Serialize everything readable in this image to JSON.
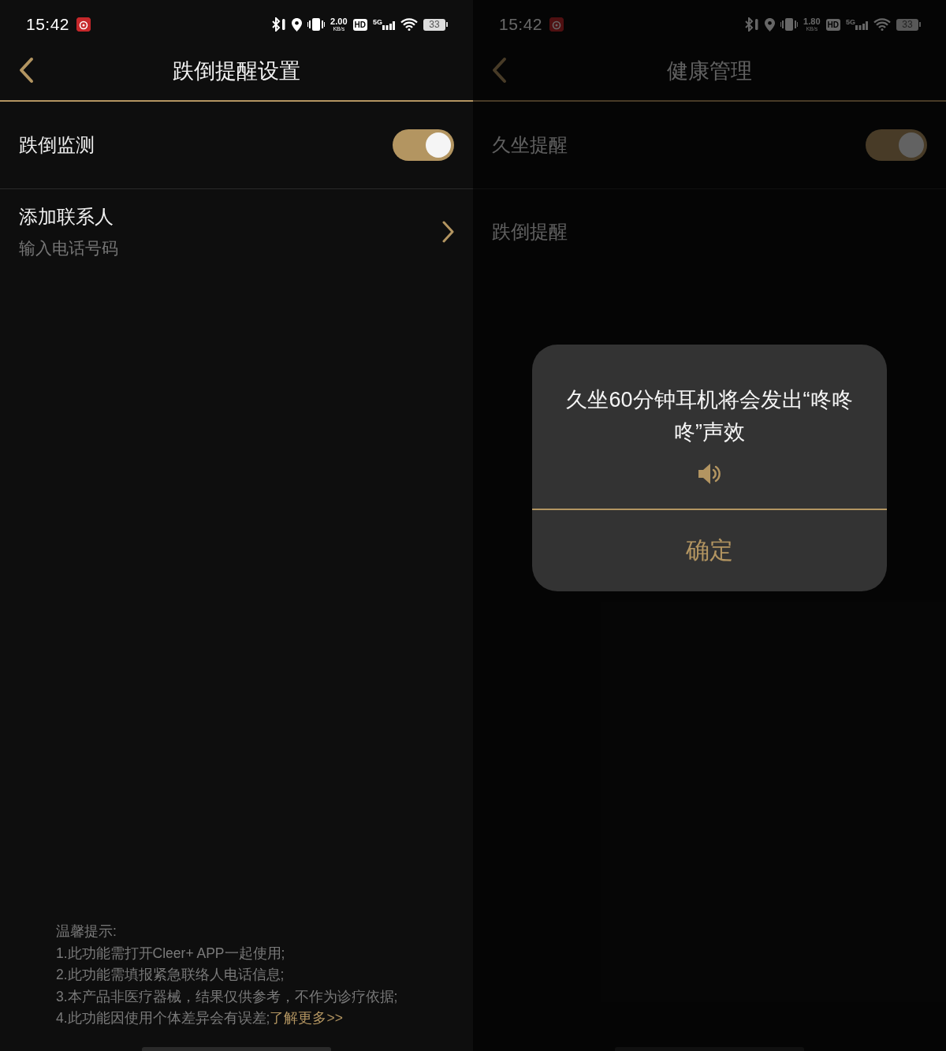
{
  "screens": [
    {
      "status_bar": {
        "time": "15:42",
        "speed": "2.00",
        "speed_unit": "KB/s",
        "hd": "HD",
        "network": "5G",
        "battery": "33"
      },
      "header": {
        "title": "跌倒提醒设置"
      },
      "rows": [
        {
          "kind": "toggle",
          "label": "跌倒监测",
          "on": true
        },
        {
          "kind": "link",
          "label": "添加联系人",
          "sublabel": "输入电话号码"
        }
      ],
      "notes": {
        "title": "温馨提示:",
        "lines": [
          "1.此功能需打开Cleer+ APP一起使用;",
          "2.此功能需填报紧急联络人电话信息;",
          "3.本产品非医疗器械，结果仅供参考，不作为诊疗依据;",
          "4.此功能因使用个体差异会有误差;"
        ],
        "link": "了解更多>>"
      }
    },
    {
      "status_bar": {
        "time": "15:42",
        "speed": "1.80",
        "speed_unit": "KB/s",
        "hd": "HD",
        "network": "5G",
        "battery": "33"
      },
      "header": {
        "title": "健康管理"
      },
      "rows": [
        {
          "kind": "toggle",
          "label": "久坐提醒",
          "on": true
        },
        {
          "kind": "plain",
          "label": "跌倒提醒"
        }
      ],
      "dialog": {
        "message": "久坐60分钟耳机将会发出“咚咚咚”声效",
        "button": "确定"
      }
    }
  ]
}
